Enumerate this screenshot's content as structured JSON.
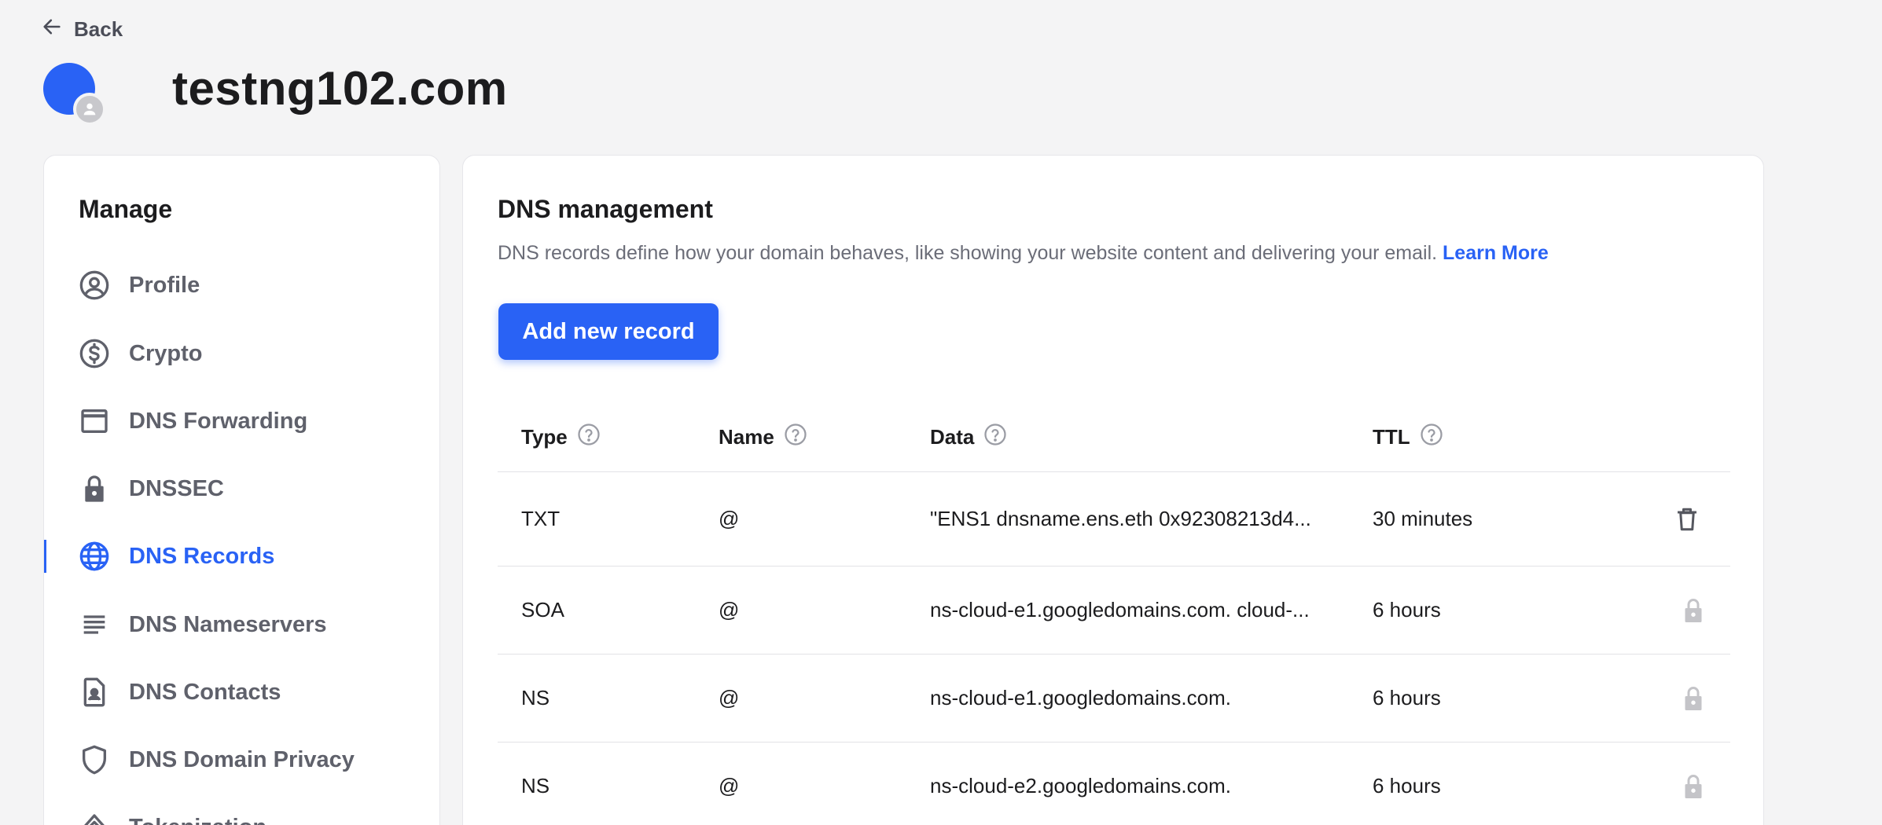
{
  "nav": {
    "back_label": "Back"
  },
  "domain": {
    "title": "testng102.com"
  },
  "sidebar": {
    "title": "Manage",
    "items": [
      {
        "label": "Profile",
        "icon": "profile-icon"
      },
      {
        "label": "Crypto",
        "icon": "dollar-circle-icon"
      },
      {
        "label": "DNS Forwarding",
        "icon": "window-icon"
      },
      {
        "label": "DNSSEC",
        "icon": "lock-icon"
      },
      {
        "label": "DNS Records",
        "icon": "globe-icon",
        "active": true
      },
      {
        "label": "DNS Nameservers",
        "icon": "lines-icon"
      },
      {
        "label": "DNS Contacts",
        "icon": "contact-file-icon"
      },
      {
        "label": "DNS Domain Privacy",
        "icon": "shield-icon"
      },
      {
        "label": "Tokenization",
        "icon": "tokenization-icon"
      }
    ]
  },
  "main": {
    "title": "DNS management",
    "description": "DNS records define how your domain behaves, like showing your website content and delivering your email. ",
    "learn_more": "Learn More",
    "add_button": "Add new record",
    "columns": [
      "Type",
      "Name",
      "Data",
      "TTL"
    ],
    "records": [
      {
        "type": "TXT",
        "name": "@",
        "data": "\"ENS1 dnsname.ens.eth 0x92308213d4...",
        "ttl": "30 minutes",
        "action": "delete-icon"
      },
      {
        "type": "SOA",
        "name": "@",
        "data": "ns-cloud-e1.googledomains.com. cloud-...",
        "ttl": "6 hours",
        "action": "lock-icon"
      },
      {
        "type": "NS",
        "name": "@",
        "data": "ns-cloud-e1.googledomains.com.",
        "ttl": "6 hours",
        "action": "lock-icon"
      },
      {
        "type": "NS",
        "name": "@",
        "data": "ns-cloud-e2.googledomains.com.",
        "ttl": "6 hours",
        "action": "lock-icon"
      }
    ]
  },
  "colors": {
    "accent": "#2962f5",
    "muted_text": "#5f616b",
    "background": "#f4f4f5"
  }
}
